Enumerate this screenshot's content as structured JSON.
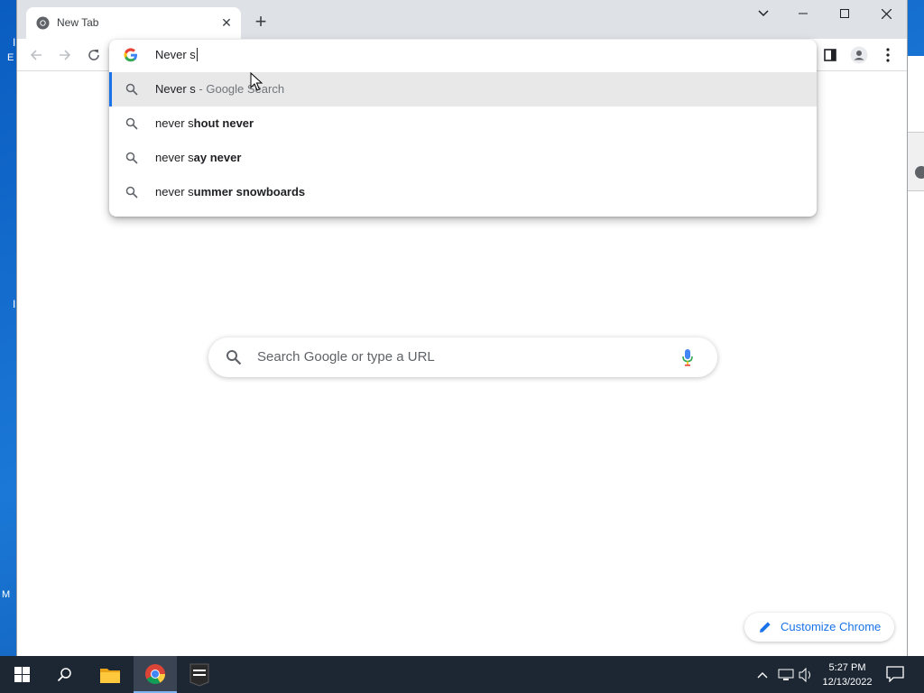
{
  "browser": {
    "tab_title": "New Tab",
    "new_tab_symbol": "+",
    "close_symbol": "✕"
  },
  "omnibox": {
    "typed_text": "Never s",
    "suggestions": [
      {
        "typed": "Never s",
        "completion": "",
        "suffix": "Google Search",
        "separator": " - ",
        "selected": true
      },
      {
        "typed": "never s",
        "completion": "hout never",
        "suffix": "",
        "separator": "",
        "selected": false
      },
      {
        "typed": "never s",
        "completion": "ay never",
        "suffix": "",
        "separator": "",
        "selected": false
      },
      {
        "typed": "never s",
        "completion": "ummer snowboards",
        "suffix": "",
        "separator": "",
        "selected": false
      }
    ]
  },
  "ntp": {
    "search_placeholder": "Search Google or type a URL",
    "customize_label": "Customize Chrome"
  },
  "taskbar": {
    "time": "5:27 PM",
    "date": "12/13/2022"
  },
  "colors": {
    "accent": "#1a73e8",
    "titlebar": "#dee1e6",
    "taskbar": "#1d2733"
  }
}
